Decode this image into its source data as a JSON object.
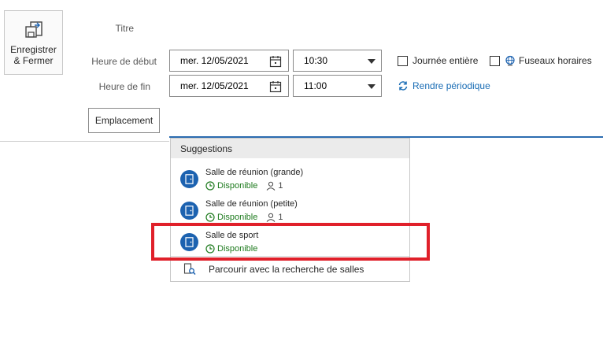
{
  "save_button": {
    "label": "Enregistrer\n& Fermer",
    "icon": "save-close-icon"
  },
  "fields": {
    "title_label": "Titre",
    "start_label": "Heure de début",
    "end_label": "Heure de fin",
    "start_date": "mer. 12/05/2021",
    "start_time": "10:30",
    "end_date": "mer. 12/05/2021",
    "end_time": "11:00"
  },
  "options": {
    "all_day": "Journée entière",
    "time_zones": "Fuseaux horaires",
    "recurrence": "Rendre périodique"
  },
  "location": {
    "button_label": "Emplacement"
  },
  "suggestions": {
    "header": "Suggestions",
    "rooms": [
      {
        "name": "Salle de réunion (grande)",
        "status": "Disponible",
        "capacity": "1"
      },
      {
        "name": "Salle de réunion (petite)",
        "status": "Disponible",
        "capacity": "1"
      },
      {
        "name": "Salle de sport",
        "status": "Disponible"
      }
    ],
    "browse_label": "Parcourir avec la recherche de salles"
  },
  "colors": {
    "accent": "#1c62b0",
    "available": "#1d7a1d",
    "highlight": "#e0202a"
  }
}
